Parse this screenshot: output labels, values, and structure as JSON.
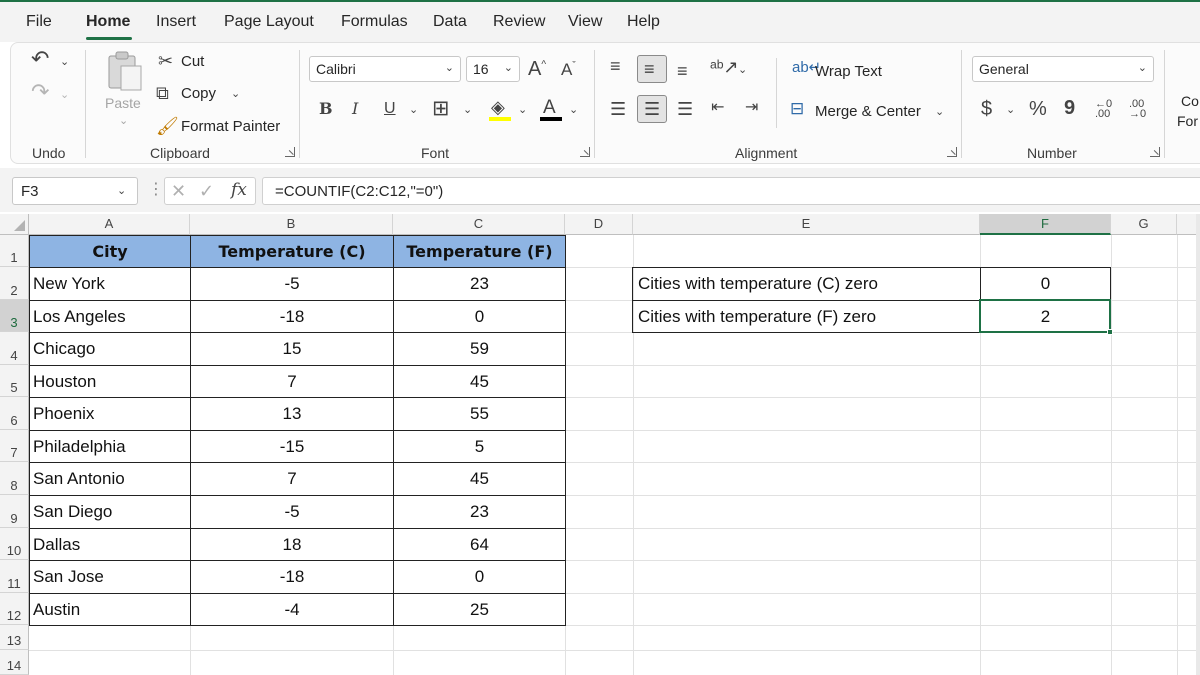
{
  "menu": {
    "tabs": [
      "File",
      "Home",
      "Insert",
      "Page Layout",
      "Formulas",
      "Data",
      "Review",
      "View",
      "Help"
    ],
    "active": "Home"
  },
  "ribbon": {
    "undo_label": "Undo",
    "clipboard": {
      "paste": "Paste",
      "cut": "Cut",
      "copy": "Copy",
      "format_painter": "Format Painter",
      "label": "Clipboard"
    },
    "font": {
      "name": "Calibri",
      "size": "16",
      "label": "Font",
      "bold": "B",
      "italic": "I",
      "underline": "U",
      "grow": "A",
      "shrink": "A"
    },
    "alignment": {
      "wrap_text": "Wrap Text",
      "merge_center": "Merge & Center",
      "label": "Alignment"
    },
    "number": {
      "format": "General",
      "currency": "$",
      "percent": "%",
      "comma": "9",
      "label": "Number"
    },
    "cut_off": {
      "line1": "Co",
      "line2": "For"
    }
  },
  "formula_bar": {
    "name_box": "F3",
    "fx": "fx",
    "formula": "=COUNTIF(C2:C12,\"=0\")"
  },
  "grid": {
    "columns": [
      "A",
      "B",
      "C",
      "D",
      "E",
      "F",
      "G"
    ],
    "selected_column": "F",
    "rows": [
      "1",
      "2",
      "3",
      "4",
      "5",
      "6",
      "7",
      "8",
      "9",
      "10",
      "11",
      "12",
      "13",
      "14"
    ],
    "table": {
      "headers": [
        "City",
        "Temperature (C)",
        "Temperature (F)"
      ],
      "rows": [
        [
          "New York",
          "-5",
          "23"
        ],
        [
          "Los Angeles",
          "-18",
          "0"
        ],
        [
          "Chicago",
          "15",
          "59"
        ],
        [
          "Houston",
          "7",
          "45"
        ],
        [
          "Phoenix",
          "13",
          "55"
        ],
        [
          "Philadelphia",
          "-15",
          "5"
        ],
        [
          "San Antonio",
          "7",
          "45"
        ],
        [
          "San Diego",
          "-5",
          "23"
        ],
        [
          "Dallas",
          "18",
          "64"
        ],
        [
          "San Jose",
          "-18",
          "0"
        ],
        [
          "Austin",
          "-4",
          "25"
        ]
      ]
    },
    "summary": [
      {
        "label": "Cities with temperature (C) zero",
        "value": "0"
      },
      {
        "label": "Cities with temperature (F) zero",
        "value": "2"
      }
    ],
    "selected_cell": "F3"
  },
  "colors": {
    "accent": "#1e7145",
    "header_fill": "#8eb4e3"
  }
}
